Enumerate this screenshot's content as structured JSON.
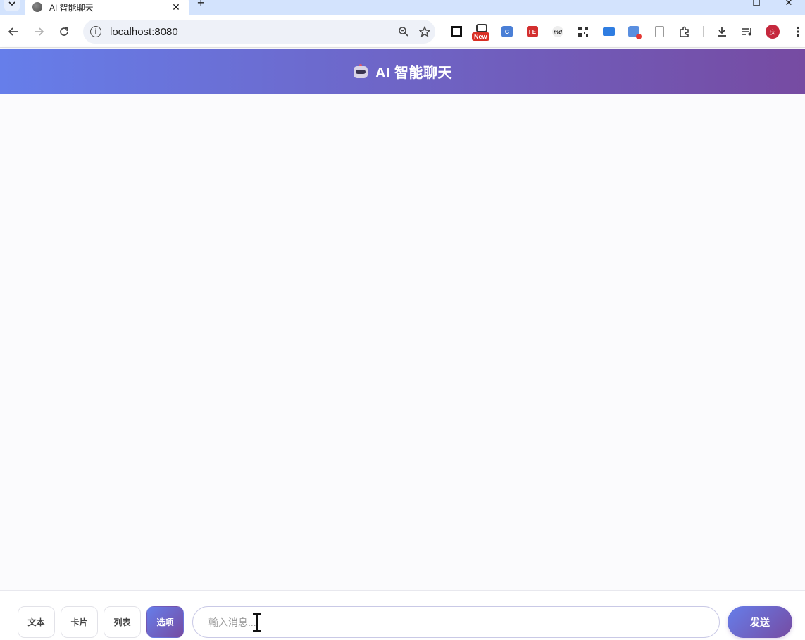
{
  "browser": {
    "tab_title": "AI 智能聊天",
    "tab_close": "✕",
    "new_tab": "+",
    "url": "localhost:8080",
    "ext_new_badge": "New",
    "ext_fe_label": "FE",
    "ext_md_label": "md",
    "avatar_initial": "庆",
    "window_controls": [
      "—",
      "☐",
      "✕"
    ]
  },
  "app": {
    "title": "AI 智能聊天",
    "header_gradient": [
      "#667eea",
      "#764ba2"
    ]
  },
  "input_bar": {
    "type_buttons": [
      {
        "label": "文本",
        "active": false
      },
      {
        "label": "卡片",
        "active": false
      },
      {
        "label": "列表",
        "active": false
      },
      {
        "label": "选项",
        "active": true
      }
    ],
    "placeholder": "輸入消息...",
    "send_label": "发送"
  }
}
